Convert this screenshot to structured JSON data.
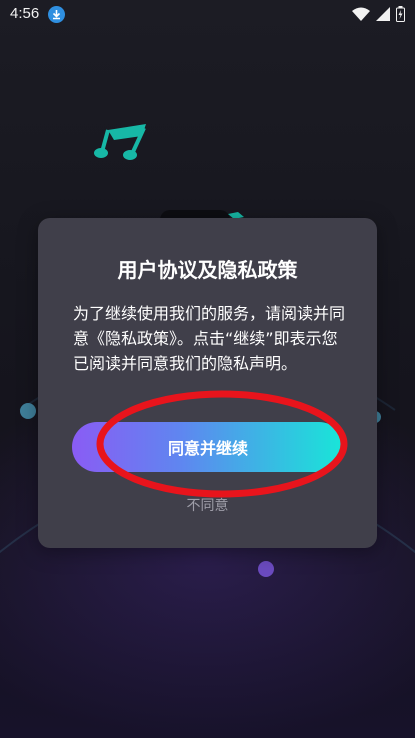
{
  "status_bar": {
    "time": "4:56"
  },
  "dialog": {
    "title": "用户协议及隐私政策",
    "body": "为了继续使用我们的服务，请阅读并同意《隐私政策》。点击“继续”即表示您已阅读并同意我们的隐私声明。",
    "agree_button": "同意并继续",
    "disagree_link": "不同意"
  },
  "colors": {
    "dialog_bg": "#403f4a",
    "button_gradient_start": "#8a5cf4",
    "button_gradient_end": "#18e6d8",
    "annotation_circle": "#e8141c",
    "music_note": "#17b8a6"
  },
  "icons": [
    "download-icon",
    "wifi-icon",
    "signal-icon",
    "battery-icon",
    "music-note-icon"
  ]
}
